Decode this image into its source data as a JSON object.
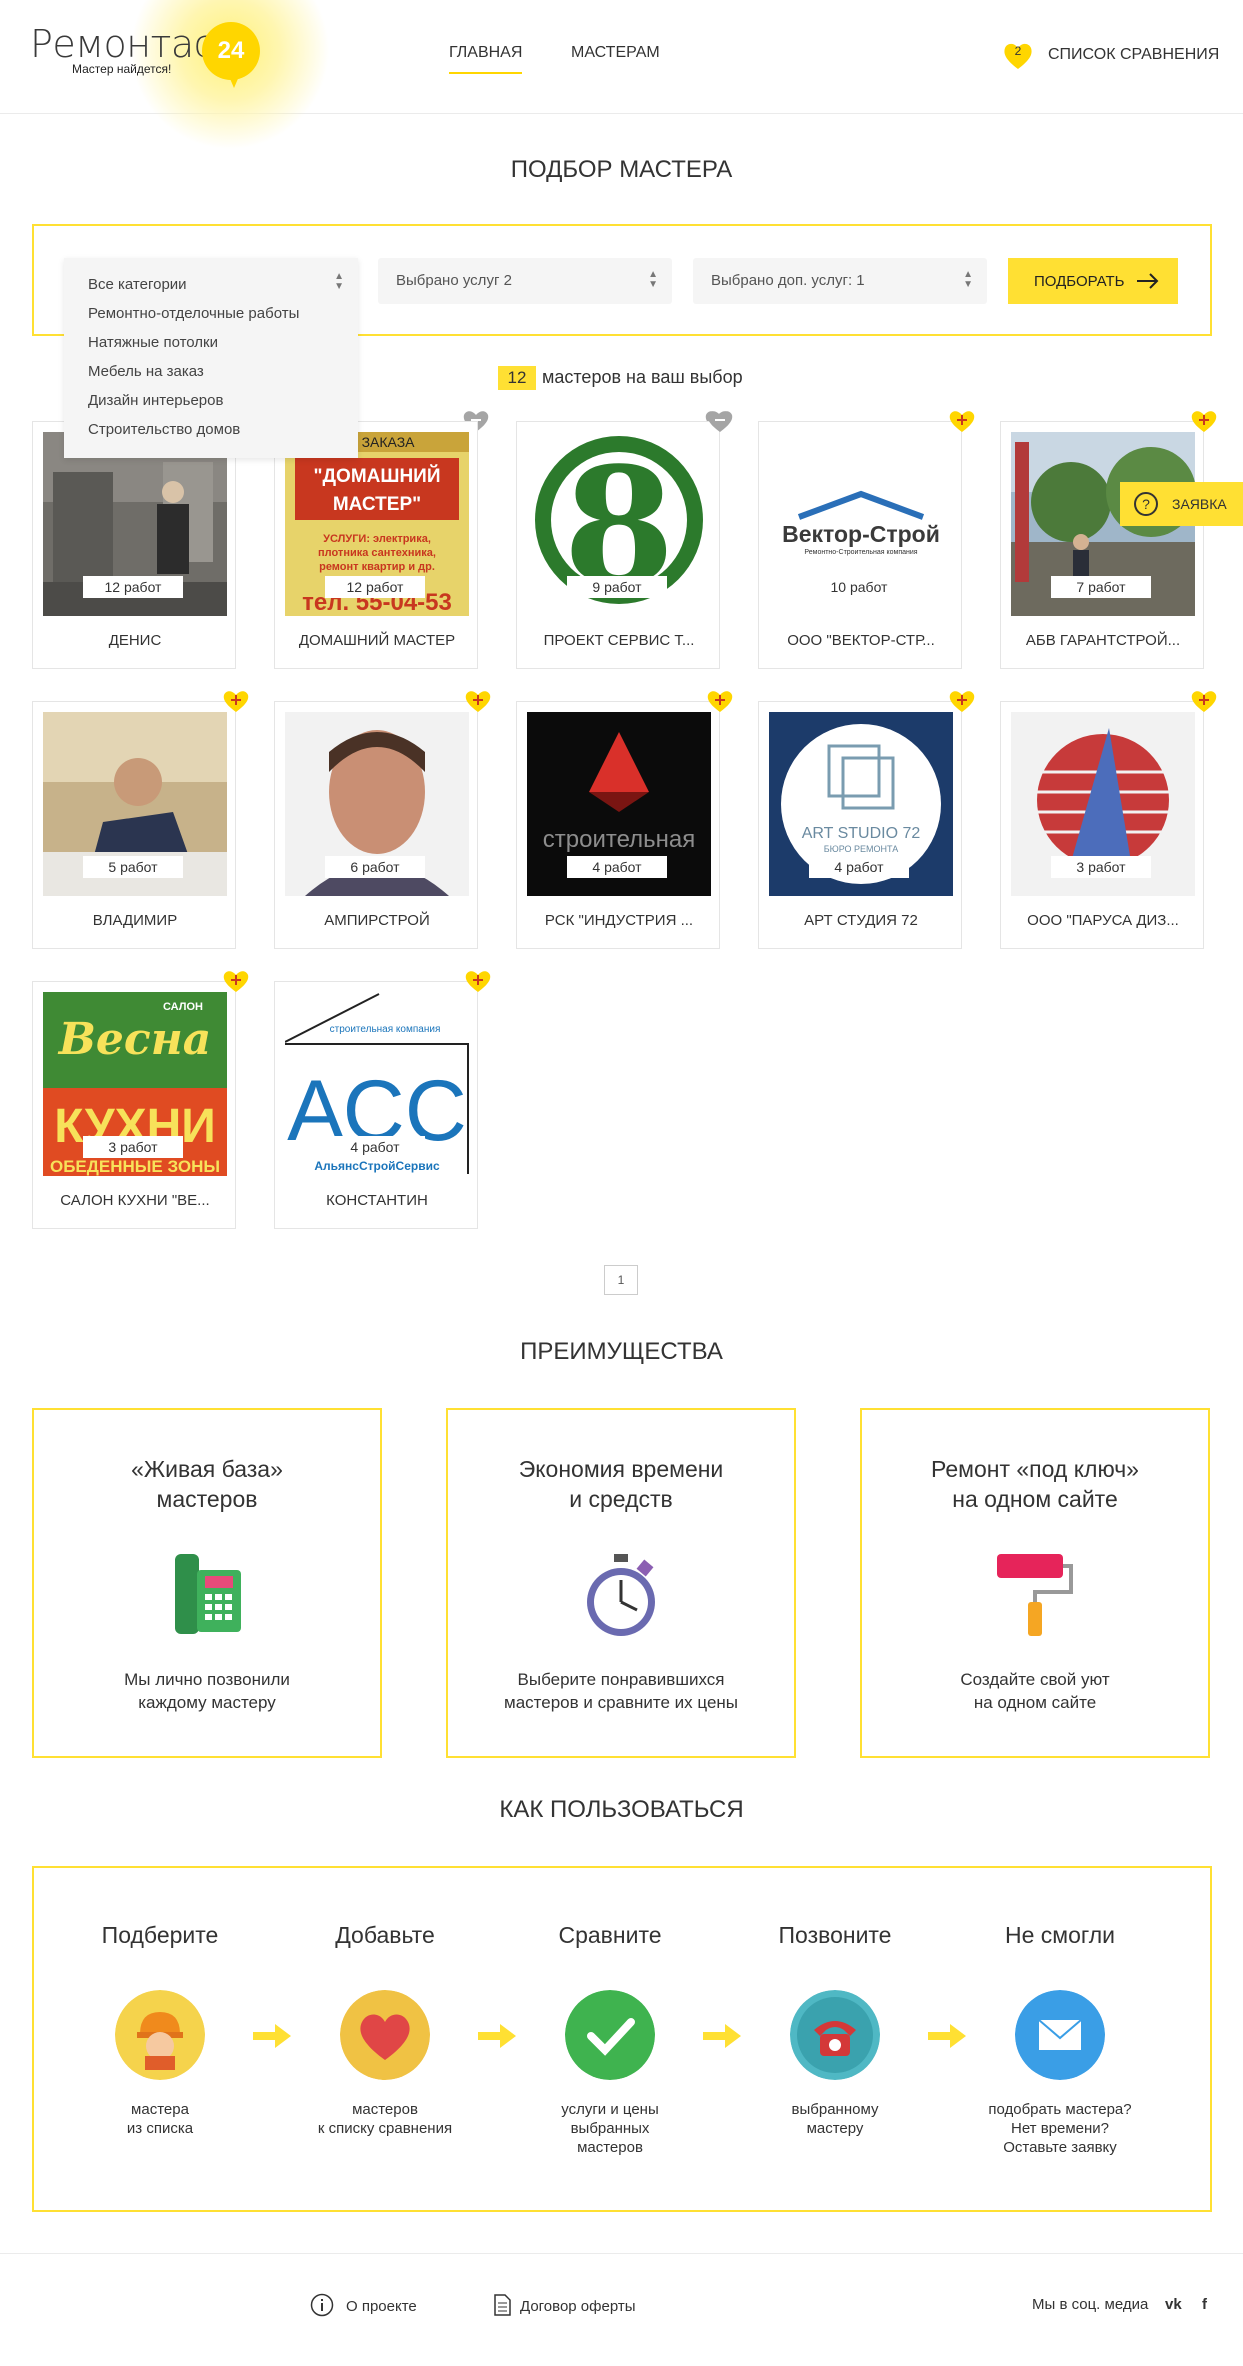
{
  "header": {
    "logo_text": "Ремонтас",
    "logo_badge": "24",
    "logo_tagline": "Мастер найдется!",
    "nav": [
      {
        "label": "ГЛАВНАЯ",
        "active": true
      },
      {
        "label": "МАСТЕРАМ",
        "active": false
      }
    ],
    "compare": {
      "count": "2",
      "label": "СПИСОК СРАВНЕНИЯ"
    }
  },
  "search": {
    "title": "ПОДБОР МАСТЕРА",
    "category_select": {
      "selected": "Все категории",
      "options": [
        "Все категории",
        "Ремонтно-отделочные работы",
        "Натяжные потолки",
        "Мебель на заказ",
        "Дизайн интерьеров",
        "Строительство домов"
      ]
    },
    "services_select": "Выбрано услуг 2",
    "extra_services_select": "Выбрано доп. услуг: 1",
    "pick_button": "ПОДБОРАТЬ"
  },
  "results": {
    "count": "12",
    "count_label": "мастеров на ваш выбор"
  },
  "float_tab": {
    "label": "ЗАЯВКА"
  },
  "masters": [
    {
      "name": "ДЕНИС",
      "works": "12 работ",
      "in_compare": true,
      "image": "photo-workshop"
    },
    {
      "name": "ДОМАШНИЙ МАСТЕР",
      "works": "12 работ",
      "in_compare": true,
      "image": "ad-domashniy-master",
      "img_text_top": "БА ЗАКАЗА",
      "img_text_main": "\"ДОМАШНИЙ МАСТЕР\"",
      "img_text_services": "УСЛУГИ: электрика, плотника сантехника, ремонт квартир и др.",
      "img_text_phone": "тел. 55-04-53"
    },
    {
      "name": "ПРОЕКТ СЕРВИС Т...",
      "works": "9 работ",
      "in_compare": true,
      "image": "logo-8",
      "img_text": "8"
    },
    {
      "name": "ООО \"ВЕКТОР-СТР...",
      "works": "10 работ",
      "in_compare": false,
      "image": "logo-vektor-stroy",
      "img_text": "Вектор-Строй",
      "img_text_sub": "Ремонтно-Строительная компания"
    },
    {
      "name": "АБВ ГАРАНТСТРОЙ...",
      "works": "7 работ",
      "in_compare": false,
      "image": "photo-park"
    },
    {
      "name": "ВЛАДИМИР",
      "works": "5 работ",
      "in_compare": false,
      "image": "photo-man-desk"
    },
    {
      "name": "АМПИРСТРОЙ",
      "works": "6 работ",
      "in_compare": false,
      "image": "photo-portrait"
    },
    {
      "name": "РСК \"ИНДУСТРИЯ ...",
      "works": "4 работ",
      "in_compare": false,
      "image": "logo-industriya",
      "img_text": "строительная"
    },
    {
      "name": "АРТ СТУДИЯ 72",
      "works": "4 работ",
      "in_compare": false,
      "image": "logo-art-studio",
      "img_text": "ART STUDIO 72",
      "img_text_sub": "БЮРО РЕМОНТА"
    },
    {
      "name": "ООО \"ПАРУСА ДИЗ...",
      "works": "3 работ",
      "in_compare": false,
      "image": "logo-parusa"
    },
    {
      "name": "САЛОН КУХНИ \"ВЕ...",
      "works": "3 работ",
      "in_compare": false,
      "image": "logo-vesna",
      "img_text_top": "САЛОН",
      "img_text_main": "Весна",
      "img_text_big": "КУХНИ",
      "img_text_bottom": "ОБЕДЕННЫЕ ЗОНЫ"
    },
    {
      "name": "КОНСТАНТИН",
      "works": "4 работ",
      "in_compare": false,
      "image": "logo-acc",
      "img_text_top": "строительная компания",
      "img_text_main": "АСС",
      "img_text_bottom": "АльянсСтройСервис"
    }
  ],
  "pagination": {
    "current": "1"
  },
  "advantages": {
    "title": "ПРЕИМУЩЕСТВА",
    "items": [
      {
        "title_line1": "«Живая база»",
        "title_line2": "мастеров",
        "desc_line1": "Мы лично позвонили",
        "desc_line2": "каждому мастеру",
        "icon": "phone-icon"
      },
      {
        "title_line1": "Экономия времени",
        "title_line2": "и средств",
        "desc_line1": "Выберите понравившихся",
        "desc_line2": "мастеров и сравните их цены",
        "icon": "stopwatch-icon"
      },
      {
        "title_line1": "Ремонт «под ключ»",
        "title_line2": "на одном сайте",
        "desc_line1": "Создайте свой уют",
        "desc_line2": "на одном сайте",
        "icon": "paint-roller-icon"
      }
    ]
  },
  "how_to": {
    "title": "КАК ПОЛЬЗОВАТЬСЯ",
    "steps": [
      {
        "title": "Подберите",
        "desc": [
          "мастера",
          "из списка"
        ],
        "icon": "worker-icon",
        "color": "#f5d34c"
      },
      {
        "title": "Добавьте",
        "desc": [
          "мастеров",
          "к списку сравнения"
        ],
        "icon": "heart-icon",
        "color": "#f0c244"
      },
      {
        "title": "Сравните",
        "desc": [
          "услуги и цены",
          "выбранных",
          "мастеров"
        ],
        "icon": "check-icon",
        "color": "#3fb34f"
      },
      {
        "title": "Позвоните",
        "desc": [
          "выбранному",
          "мастеру"
        ],
        "icon": "telephone-icon",
        "color": "#4fb8c4"
      },
      {
        "title": "Не смогли",
        "desc": [
          "подобрать мастера?",
          "Нет времени?",
          "Оставьте заявку"
        ],
        "icon": "envelope-icon",
        "color": "#3a9ee6"
      }
    ]
  },
  "footer": {
    "about": "О проекте",
    "offer": "Договор оферты",
    "social_label": "Мы в соц. медиа",
    "vk": "vk",
    "fb": "f"
  },
  "colors": {
    "accent": "#ffe033",
    "heart": "#ffd600",
    "heart_inactive": "#a5a5a5"
  }
}
